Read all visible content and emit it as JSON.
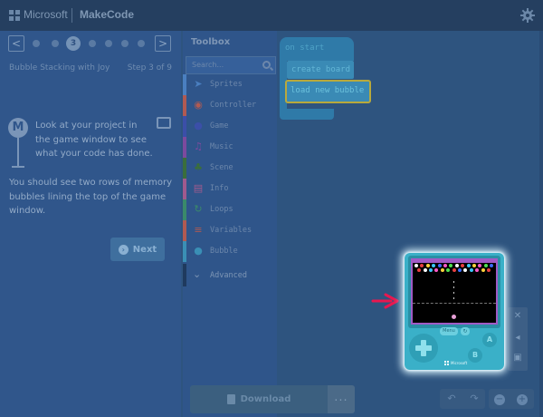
{
  "header": {
    "brand": "Microsoft",
    "app": "MakeCode",
    "settings_icon": "gear-icon"
  },
  "tutorial": {
    "nav_prev": "<",
    "nav_next": ">",
    "current_step_number": "3",
    "title": "Bubble Stacking with Joy",
    "step_label": "Step 3 of 9",
    "paragraph1": "Look at your project in the game window to see what your code has done.",
    "paragraph2": "You should see two rows of memory bubbles lining the top of the game window.",
    "next_label": "Next"
  },
  "toolbox": {
    "title": "Toolbox",
    "search_placeholder": "Search...",
    "categories": [
      {
        "label": "Sprites",
        "color": "#4a7fc0",
        "icon": "paper-plane-icon",
        "glyph": "➤"
      },
      {
        "label": "Controller",
        "color": "#b05a52",
        "icon": "gamepad-icon",
        "glyph": "◉"
      },
      {
        "label": "Game",
        "color": "#3b4fa8",
        "icon": "circle-icon",
        "glyph": "●"
      },
      {
        "label": "Music",
        "color": "#7c4a9e",
        "icon": "headphones-icon",
        "glyph": "♫"
      },
      {
        "label": "Scene",
        "color": "#3a6e3c",
        "icon": "tree-icon",
        "glyph": "♣"
      },
      {
        "label": "Info",
        "color": "#a05a8e",
        "icon": "id-card-icon",
        "glyph": "▤"
      },
      {
        "label": "Loops",
        "color": "#3a8a6a",
        "icon": "refresh-icon",
        "glyph": "↻"
      },
      {
        "label": "Variables",
        "color": "#b05a52",
        "icon": "list-icon",
        "glyph": "≡"
      },
      {
        "label": "Bubble",
        "color": "#3a8fb5",
        "icon": "bubble-icon",
        "glyph": "●"
      }
    ],
    "advanced_label": "Advanced"
  },
  "workspace": {
    "blocks": {
      "hat": "on start",
      "inner1": "create board",
      "inner2": "load new bubble"
    }
  },
  "bottom": {
    "download_label": "Download",
    "more_label": "..."
  },
  "simulator": {
    "menu_label": "Menu",
    "btn_a": "A",
    "btn_b": "B",
    "brand": "Microsoft",
    "bubble_colors": [
      "#ffffff",
      "#e84040",
      "#ffd23c",
      "#3ac8ff",
      "#3a6cff",
      "#ff5ac8",
      "#50e050",
      "#ffffff",
      "#e84040",
      "#3ac8ff",
      "#ffd23c",
      "#ff5ac8",
      "#50e050",
      "#3a6cff",
      "#e84040",
      "#ffffff",
      "#3ac8ff",
      "#ff5ac8",
      "#ffd23c",
      "#50e050",
      "#e84040",
      "#3a6cff",
      "#ffffff",
      "#3ac8ff",
      "#ff5ac8",
      "#ffd23c",
      "#e84040"
    ]
  }
}
